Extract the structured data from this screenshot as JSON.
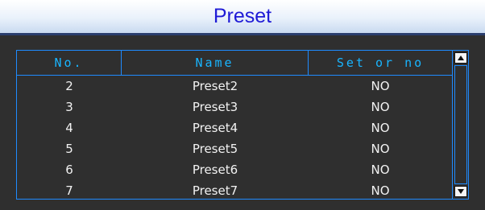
{
  "header": {
    "title": "Preset"
  },
  "table": {
    "columns": [
      "No.",
      "Name",
      "Set or no"
    ],
    "rows": [
      [
        "2",
        "Preset2",
        "NO"
      ],
      [
        "3",
        "Preset3",
        "NO"
      ],
      [
        "4",
        "Preset4",
        "NO"
      ],
      [
        "5",
        "Preset5",
        "NO"
      ],
      [
        "6",
        "Preset6",
        "NO"
      ],
      [
        "7",
        "Preset7",
        "NO"
      ]
    ]
  },
  "scrollbar": {
    "up_icon": "arrow-up-icon",
    "down_icon": "arrow-down-icon"
  },
  "colors": {
    "accent": "#1f8bff",
    "header_text": "#19b5ff",
    "title": "#1f1bd6",
    "background": "#2f2f2f"
  }
}
